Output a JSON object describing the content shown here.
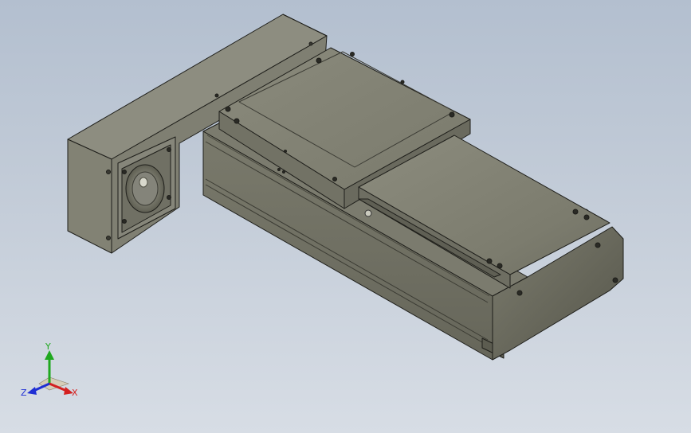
{
  "viewport": {
    "background_top": "#b3bfcf",
    "background_bottom": "#d7dde5"
  },
  "model": {
    "body_color": "#7c7c6e",
    "edge_color": "#1e1e1a"
  },
  "triad": {
    "x_label": "X",
    "y_label": "Y",
    "z_label": "Z",
    "x_color": "#d42020",
    "y_color": "#1fa81f",
    "z_color": "#1f2fd4"
  }
}
